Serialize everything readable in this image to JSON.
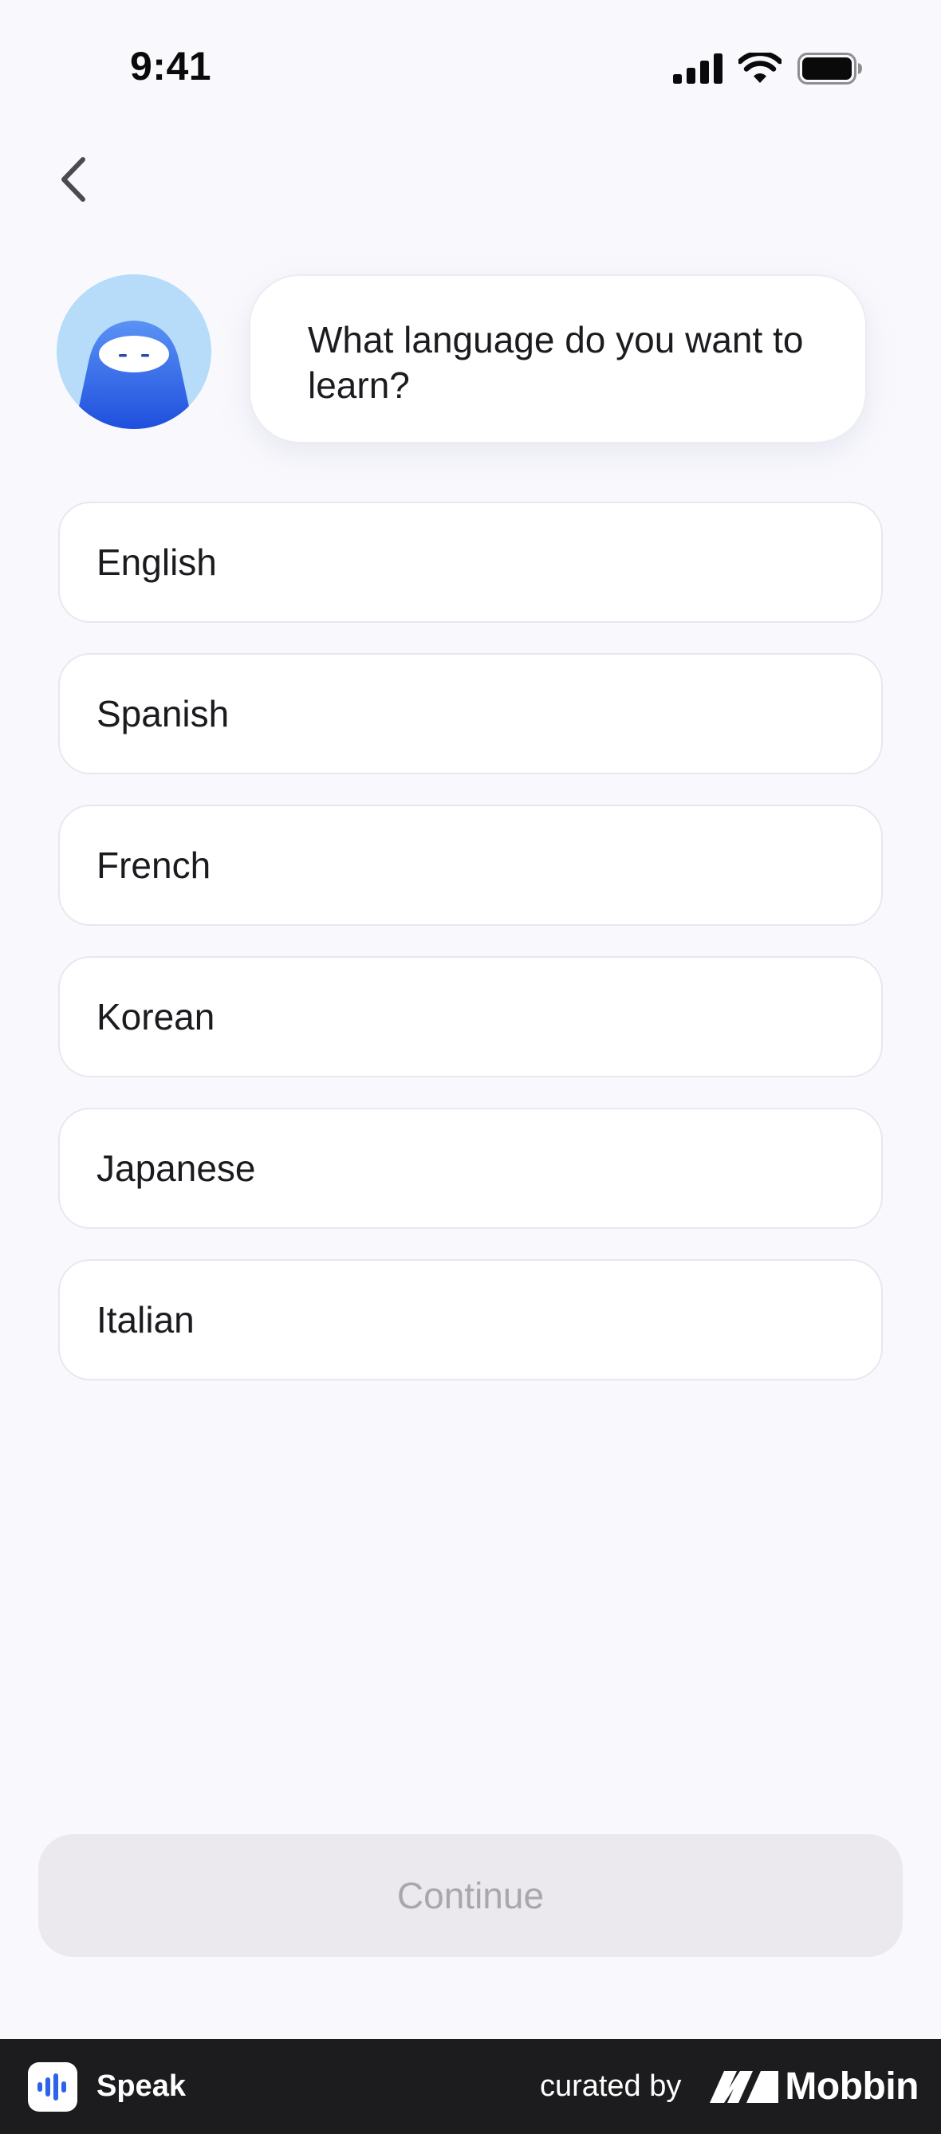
{
  "status_bar": {
    "time": "9:41"
  },
  "chat": {
    "prompt": "What language do you want to learn?"
  },
  "languages": [
    "English",
    "Spanish",
    "French",
    "Korean",
    "Japanese",
    "Italian"
  ],
  "continue_label": "Continue",
  "footer": {
    "app_name": "Speak",
    "curated_by": "curated by",
    "brand": "Mobbin"
  },
  "colors": {
    "background": "#f9f9fd",
    "avatar_blue": "#2d63e8",
    "button_disabled": "#ebe9ee",
    "footer": "#1c1c1e"
  }
}
